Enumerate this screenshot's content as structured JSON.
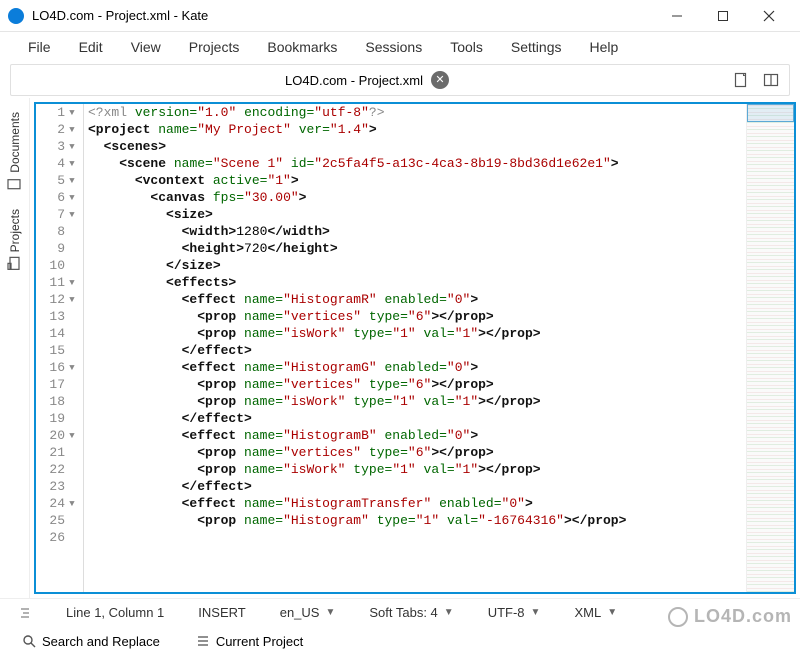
{
  "window": {
    "title": "LO4D.com - Project.xml - Kate"
  },
  "menu": [
    "File",
    "Edit",
    "View",
    "Projects",
    "Bookmarks",
    "Sessions",
    "Tools",
    "Settings",
    "Help"
  ],
  "tab": {
    "label": "LO4D.com - Project.xml"
  },
  "sidebar": {
    "documents": "Documents",
    "projects": "Projects"
  },
  "code": {
    "lines": [
      {
        "n": 1,
        "fold": true,
        "html": "<span class='t-pi'>&lt;?xml</span> <span class='t-attr'>version=</span><span class='t-val'>\"1.0\"</span> <span class='t-attr'>encoding=</span><span class='t-val'>\"utf-8\"</span><span class='t-pi'>?&gt;</span>"
      },
      {
        "n": 2,
        "fold": true,
        "html": "<span class='t-tag'>&lt;project</span> <span class='t-attr'>name=</span><span class='t-val'>\"My Project\"</span> <span class='t-attr'>ver=</span><span class='t-val'>\"1.4\"</span><span class='t-tag'>&gt;</span>"
      },
      {
        "n": 3,
        "fold": true,
        "html": "  <span class='t-tag'>&lt;scenes&gt;</span>"
      },
      {
        "n": 4,
        "fold": true,
        "html": "    <span class='t-tag'>&lt;scene</span> <span class='t-attr'>name=</span><span class='t-val'>\"Scene 1\"</span> <span class='t-attr'>id=</span><span class='t-val'>\"2c5fa4f5-a13c-4ca3-8b19-8bd36d1e62e1\"</span><span class='t-tag'>&gt;</span>"
      },
      {
        "n": 5,
        "fold": true,
        "html": "      <span class='t-tag'>&lt;vcontext</span> <span class='t-attr'>active=</span><span class='t-val'>\"1\"</span><span class='t-tag'>&gt;</span>"
      },
      {
        "n": 6,
        "fold": true,
        "html": "        <span class='t-tag'>&lt;canvas</span> <span class='t-attr'>fps=</span><span class='t-val'>\"30.00\"</span><span class='t-tag'>&gt;</span>"
      },
      {
        "n": 7,
        "fold": true,
        "html": "          <span class='t-tag'>&lt;size&gt;</span>"
      },
      {
        "n": 8,
        "fold": false,
        "html": "            <span class='t-tag'>&lt;width&gt;</span><span class='t-txt'>1280</span><span class='t-tag'>&lt;/width&gt;</span>"
      },
      {
        "n": 9,
        "fold": false,
        "html": "            <span class='t-tag'>&lt;height&gt;</span><span class='t-txt'>720</span><span class='t-tag'>&lt;/height&gt;</span>"
      },
      {
        "n": 10,
        "fold": false,
        "html": "          <span class='t-tag'>&lt;/size&gt;</span>"
      },
      {
        "n": 11,
        "fold": true,
        "html": "          <span class='t-tag'>&lt;effects&gt;</span>"
      },
      {
        "n": 12,
        "fold": true,
        "html": "            <span class='t-tag'>&lt;effect</span> <span class='t-attr'>name=</span><span class='t-val'>\"HistogramR\"</span> <span class='t-attr'>enabled=</span><span class='t-val'>\"0\"</span><span class='t-tag'>&gt;</span>"
      },
      {
        "n": 13,
        "fold": false,
        "html": "              <span class='t-tag'>&lt;prop</span> <span class='t-attr'>name=</span><span class='t-val'>\"vertices\"</span> <span class='t-attr'>type=</span><span class='t-val'>\"6\"</span><span class='t-tag'>&gt;&lt;/prop&gt;</span>"
      },
      {
        "n": 14,
        "fold": false,
        "html": "              <span class='t-tag'>&lt;prop</span> <span class='t-attr'>name=</span><span class='t-val'>\"isWork\"</span> <span class='t-attr'>type=</span><span class='t-val'>\"1\"</span> <span class='t-attr'>val=</span><span class='t-val'>\"1\"</span><span class='t-tag'>&gt;&lt;/prop&gt;</span>"
      },
      {
        "n": 15,
        "fold": false,
        "html": "            <span class='t-tag'>&lt;/effect&gt;</span>"
      },
      {
        "n": 16,
        "fold": true,
        "html": "            <span class='t-tag'>&lt;effect</span> <span class='t-attr'>name=</span><span class='t-val'>\"HistogramG\"</span> <span class='t-attr'>enabled=</span><span class='t-val'>\"0\"</span><span class='t-tag'>&gt;</span>"
      },
      {
        "n": 17,
        "fold": false,
        "html": "              <span class='t-tag'>&lt;prop</span> <span class='t-attr'>name=</span><span class='t-val'>\"vertices\"</span> <span class='t-attr'>type=</span><span class='t-val'>\"6\"</span><span class='t-tag'>&gt;&lt;/prop&gt;</span>"
      },
      {
        "n": 18,
        "fold": false,
        "html": "              <span class='t-tag'>&lt;prop</span> <span class='t-attr'>name=</span><span class='t-val'>\"isWork\"</span> <span class='t-attr'>type=</span><span class='t-val'>\"1\"</span> <span class='t-attr'>val=</span><span class='t-val'>\"1\"</span><span class='t-tag'>&gt;&lt;/prop&gt;</span>"
      },
      {
        "n": 19,
        "fold": false,
        "html": "            <span class='t-tag'>&lt;/effect&gt;</span>"
      },
      {
        "n": 20,
        "fold": true,
        "html": "            <span class='t-tag'>&lt;effect</span> <span class='t-attr'>name=</span><span class='t-val'>\"HistogramB\"</span> <span class='t-attr'>enabled=</span><span class='t-val'>\"0\"</span><span class='t-tag'>&gt;</span>"
      },
      {
        "n": 21,
        "fold": false,
        "html": "              <span class='t-tag'>&lt;prop</span> <span class='t-attr'>name=</span><span class='t-val'>\"vertices\"</span> <span class='t-attr'>type=</span><span class='t-val'>\"6\"</span><span class='t-tag'>&gt;&lt;/prop&gt;</span>"
      },
      {
        "n": 22,
        "fold": false,
        "html": "              <span class='t-tag'>&lt;prop</span> <span class='t-attr'>name=</span><span class='t-val'>\"isWork\"</span> <span class='t-attr'>type=</span><span class='t-val'>\"1\"</span> <span class='t-attr'>val=</span><span class='t-val'>\"1\"</span><span class='t-tag'>&gt;&lt;/prop&gt;</span>"
      },
      {
        "n": 23,
        "fold": false,
        "html": "            <span class='t-tag'>&lt;/effect&gt;</span>"
      },
      {
        "n": 24,
        "fold": true,
        "html": "            <span class='t-tag'>&lt;effect</span> <span class='t-attr'>name=</span><span class='t-val'>\"HistogramTransfer\"</span> <span class='t-attr'>enabled=</span><span class='t-val'>\"0\"</span><span class='t-tag'>&gt;</span>"
      },
      {
        "n": 25,
        "fold": false,
        "html": "              <span class='t-tag'>&lt;prop</span> <span class='t-attr'>name=</span><span class='t-val'>\"Histogram\"</span> <span class='t-attr'>type=</span><span class='t-val'>\"1\"</span> <span class='t-attr'>val=</span><span class='t-val'>\"-16764316\"</span><span class='t-tag'>&gt;&lt;/prop&gt;</span>"
      },
      {
        "n": 26,
        "fold": false,
        "html": ""
      }
    ]
  },
  "status": {
    "position": "Line 1, Column 1",
    "mode": "INSERT",
    "locale": "en_US",
    "tabs": "Soft Tabs: 4",
    "encoding": "UTF-8",
    "syntax": "XML"
  },
  "bottom": {
    "search": "Search and Replace",
    "project": "Current Project"
  },
  "watermark": "LO4D.com"
}
